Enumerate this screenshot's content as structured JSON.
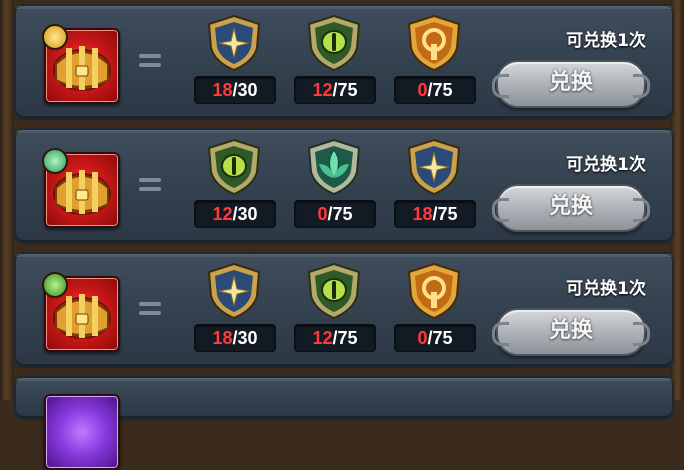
{
  "rows": [
    {
      "chest_badge": "gold-badge",
      "chest_color": "red",
      "items": [
        {
          "icon": "blue-star-shield-icon",
          "have": "18",
          "need": "/30"
        },
        {
          "icon": "green-eye-shield-icon",
          "have": "12",
          "need": "/75"
        },
        {
          "icon": "orange-ring-shield-icon",
          "have": "0",
          "need": "/75"
        }
      ],
      "limit": "可兑换1次",
      "button": "兑换"
    },
    {
      "chest_badge": "green-leaf-badge",
      "chest_color": "red",
      "items": [
        {
          "icon": "green-eye-shield-icon",
          "have": "12",
          "need": "/30"
        },
        {
          "icon": "teal-lotus-shield-icon",
          "have": "0",
          "need": "/75"
        },
        {
          "icon": "blue-star-shield-icon",
          "have": "18",
          "need": "/75"
        }
      ],
      "limit": "可兑换1次",
      "button": "兑换"
    },
    {
      "chest_badge": "green-eye-badge",
      "chest_color": "red",
      "items": [
        {
          "icon": "blue-star-shield-icon",
          "have": "18",
          "need": "/30"
        },
        {
          "icon": "green-eye-shield-icon",
          "have": "12",
          "need": "/75"
        },
        {
          "icon": "orange-ring-shield-icon",
          "have": "0",
          "need": "/75"
        }
      ],
      "limit": "可兑换1次",
      "button": "兑换"
    },
    {
      "chest_color": "purple",
      "partial": true
    }
  ],
  "colors": {
    "insufficient": "#ff3b3b",
    "panel": "#3a4756",
    "button": "#b1b6bb"
  }
}
